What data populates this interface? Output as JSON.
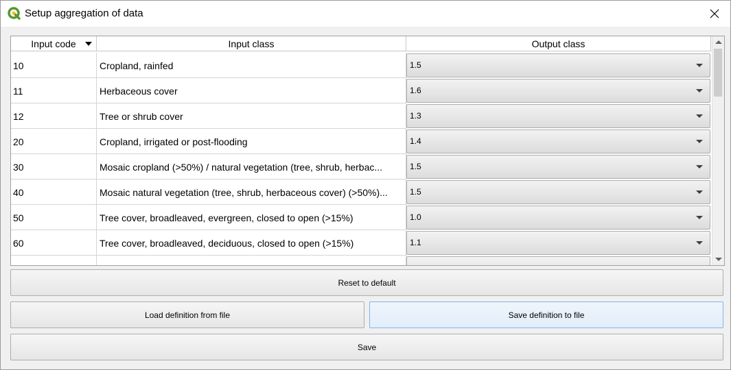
{
  "window": {
    "title": "Setup aggregation of data"
  },
  "table": {
    "columns": [
      "Input code",
      "Input class",
      "Output class"
    ],
    "rows": [
      {
        "code": "10",
        "input_class": "Cropland, rainfed",
        "output_class": "1.5"
      },
      {
        "code": "11",
        "input_class": "Herbaceous cover",
        "output_class": "1.6"
      },
      {
        "code": "12",
        "input_class": "Tree or shrub cover",
        "output_class": "1.3"
      },
      {
        "code": "20",
        "input_class": "Cropland, irrigated or post-flooding",
        "output_class": "1.4"
      },
      {
        "code": "30",
        "input_class": "Mosaic cropland (>50%) / natural vegetation (tree, shrub, herbac...",
        "output_class": "1.5"
      },
      {
        "code": "40",
        "input_class": "Mosaic natural vegetation (tree, shrub, herbaceous cover) (>50%)...",
        "output_class": "1.5"
      },
      {
        "code": "50",
        "input_class": "Tree cover, broadleaved, evergreen, closed to open (>15%)",
        "output_class": "1.0"
      },
      {
        "code": "60",
        "input_class": "Tree cover, broadleaved, deciduous, closed to open (>15%)",
        "output_class": "1.1"
      }
    ]
  },
  "buttons": {
    "reset": "Reset to default",
    "load": "Load definition from file",
    "save_def": "Save definition to file",
    "save": "Save"
  },
  "colors": {
    "focus_border": "#7eb4ea",
    "app_icon_green": "#589632",
    "app_icon_yellow": "#f0c419"
  },
  "icons": {
    "app": "qgis-logo-icon",
    "close": "close-icon",
    "sort": "sort-descending-icon",
    "dropdown": "chevron-down-icon"
  }
}
